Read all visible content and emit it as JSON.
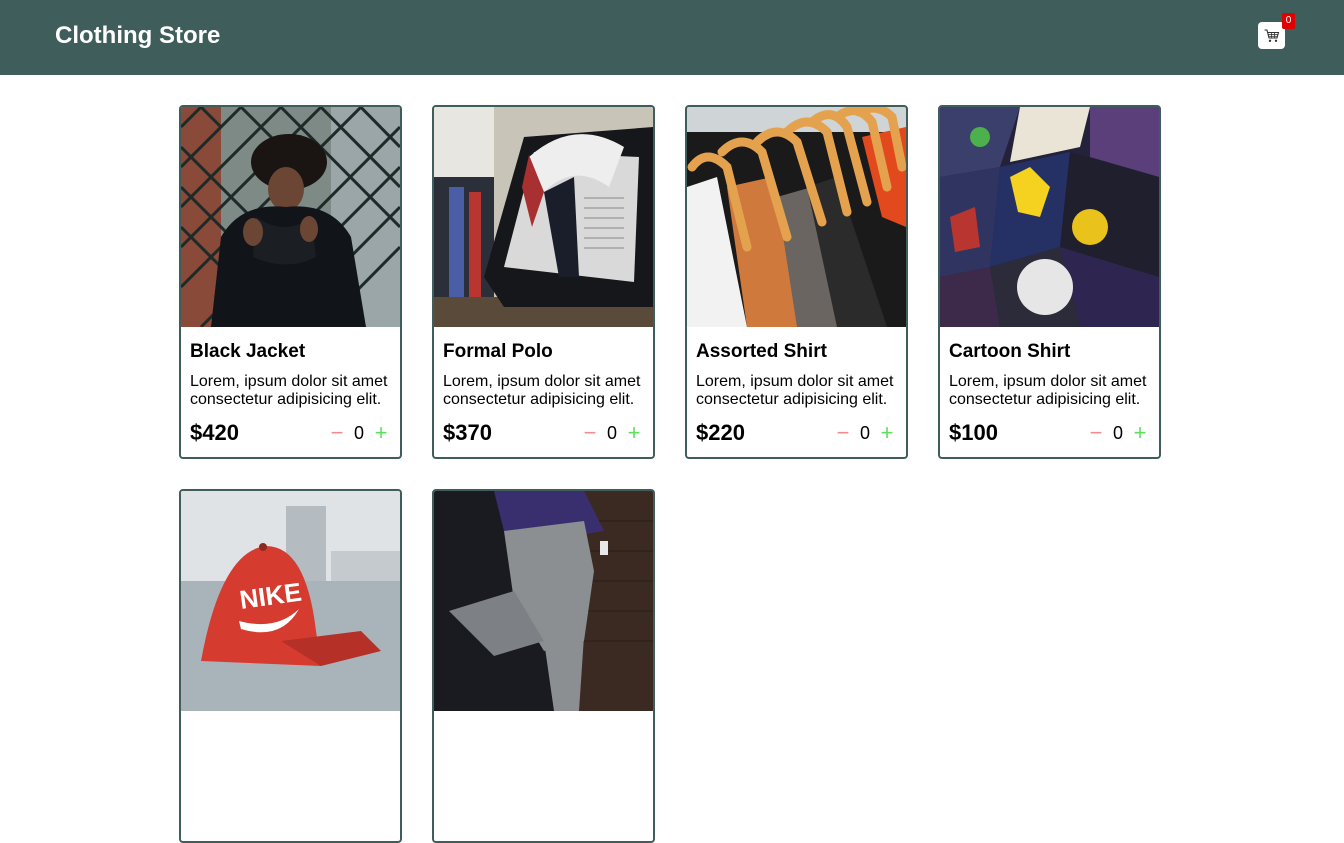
{
  "header": {
    "title": "Clothing Store",
    "cart_icon": "shopping-cart-icon",
    "cart_count": "0"
  },
  "products": [
    {
      "name": "Black Jacket",
      "description": "Lorem, ipsum dolor sit amet consectetur adipisicing elit.",
      "price": "$420",
      "quantity": "0",
      "minus": "−",
      "plus": "+"
    },
    {
      "name": "Formal Polo",
      "description": "Lorem, ipsum dolor sit amet consectetur adipisicing elit.",
      "price": "$370",
      "quantity": "0",
      "minus": "−",
      "plus": "+"
    },
    {
      "name": "Assorted Shirt",
      "description": "Lorem, ipsum dolor sit amet consectetur adipisicing elit.",
      "price": "$220",
      "quantity": "0",
      "minus": "−",
      "plus": "+"
    },
    {
      "name": "Cartoon Shirt",
      "description": "Lorem, ipsum dolor sit amet consectetur adipisicing elit.",
      "price": "$100",
      "quantity": "0",
      "minus": "−",
      "plus": "+"
    },
    {
      "name": "",
      "description": "",
      "price": "",
      "quantity": "",
      "minus": "",
      "plus": "",
      "image_text": "NIKE"
    },
    {
      "name": "",
      "description": "",
      "price": "",
      "quantity": "",
      "minus": "",
      "plus": ""
    }
  ],
  "colors": {
    "header_bg": "#3e5d5b",
    "card_border": "#3e5d5b",
    "badge": "#e00000",
    "minus": "#f08c8c",
    "plus": "#5ee05e"
  }
}
